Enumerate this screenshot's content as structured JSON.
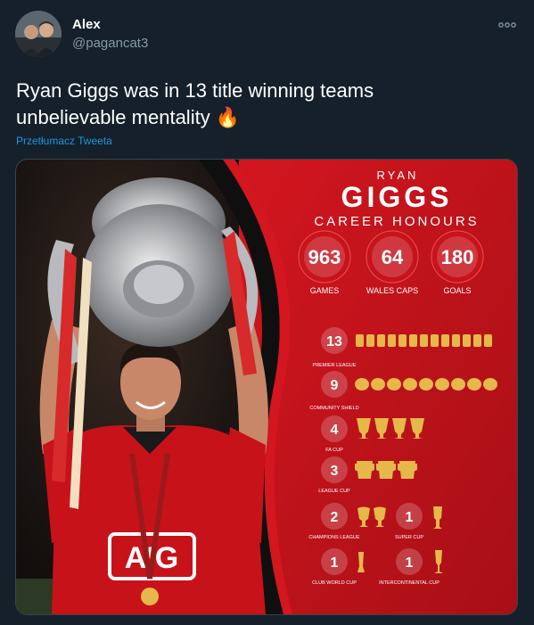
{
  "author": {
    "name": "Alex",
    "handle": "@pagancat3"
  },
  "tweet": {
    "text": "Ryan Giggs was in 13 title winning teams\nunbelievable mentality 🔥",
    "translate_label": "Przetłumacz Tweeta"
  },
  "icons": {
    "more": "more-horizontal-icon"
  },
  "infographic": {
    "first_name": "RYAN",
    "last_name": "GIGGS",
    "subtitle": "CAREER HONOURS",
    "stats": [
      {
        "value": "963",
        "label": "GAMES"
      },
      {
        "value": "64",
        "label": "WALES CAPS"
      },
      {
        "value": "180",
        "label": "GOALS"
      }
    ],
    "honours": [
      {
        "count": "13",
        "label": "PREMIER LEAGUE"
      },
      {
        "count": "9",
        "label": "COMMUNITY SHIELD"
      },
      {
        "count": "4",
        "label": "FA CUP"
      },
      {
        "count": "3",
        "label": "LEAGUE CUP"
      },
      {
        "count": "2",
        "label": "CHAMPIONS LEAGUE"
      },
      {
        "count": "1",
        "label": "SUPER CUP"
      },
      {
        "count": "1",
        "label": "CLUB WORLD CUP"
      },
      {
        "count": "1",
        "label": "INTERCONTINENTAL CUP"
      }
    ],
    "shirt_text": "AIG"
  },
  "colors": {
    "background": "#15202b",
    "link": "#1b95e0",
    "secondary_text": "#8899a6",
    "poster_red": "#c8141c",
    "trophy_gold": "#e6b84a"
  }
}
